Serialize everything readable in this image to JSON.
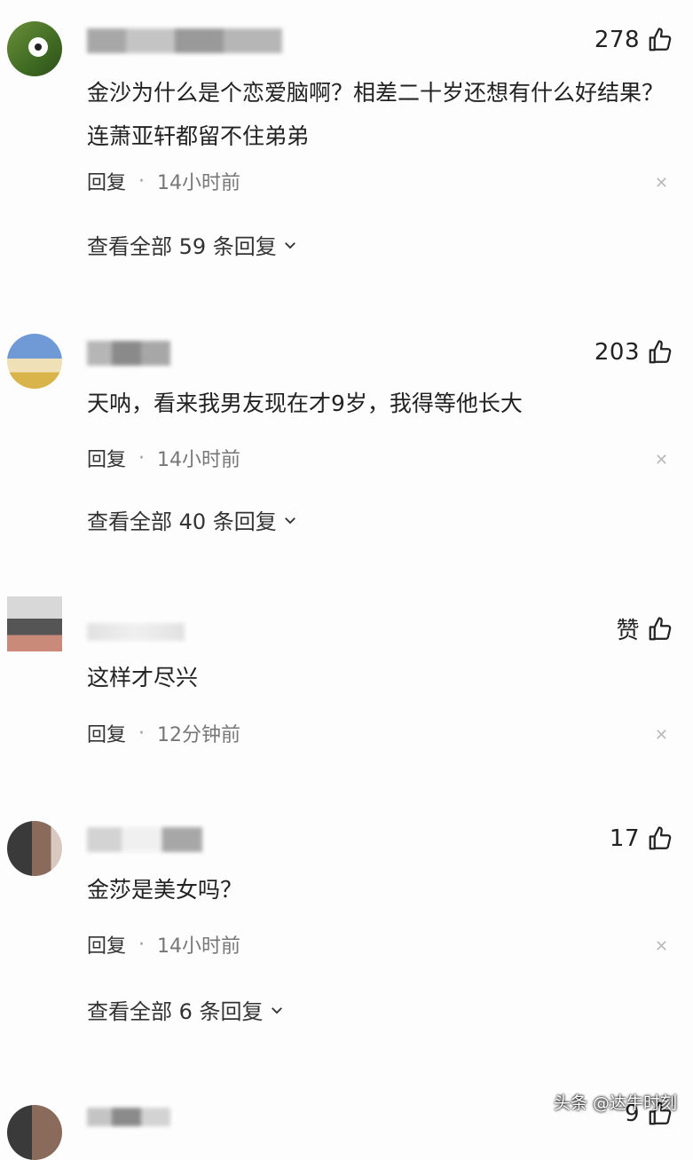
{
  "comments": [
    {
      "likes": "278",
      "text": "金沙为什么是个恋爱脑啊？相差二十岁还想有什么好结果？连萧亚轩都留不住弟弟",
      "reply_label": "回复",
      "time": "14小时前",
      "more_label": "查看全部 59 条回复"
    },
    {
      "likes": "203",
      "text": "天呐，看来我男友现在才9岁，我得等他长大",
      "reply_label": "回复",
      "time": "14小时前",
      "more_label": "查看全部 40 条回复"
    },
    {
      "likes": "赞",
      "text": "这样才尽兴",
      "reply_label": "回复",
      "time": "12分钟前"
    },
    {
      "likes": "17",
      "text": "金莎是美女吗？",
      "reply_label": "回复",
      "time": "14小时前",
      "more_label": "查看全部 6 条回复"
    },
    {
      "likes": "9"
    }
  ],
  "watermark": "头条 @达牛时刻",
  "colors": {
    "text": "#222222",
    "meta": "#777777",
    "background": "#fdfdfd"
  },
  "icons": {
    "like": "thumbs-up-icon",
    "close": "close-icon",
    "expand": "chevron-down-icon"
  }
}
